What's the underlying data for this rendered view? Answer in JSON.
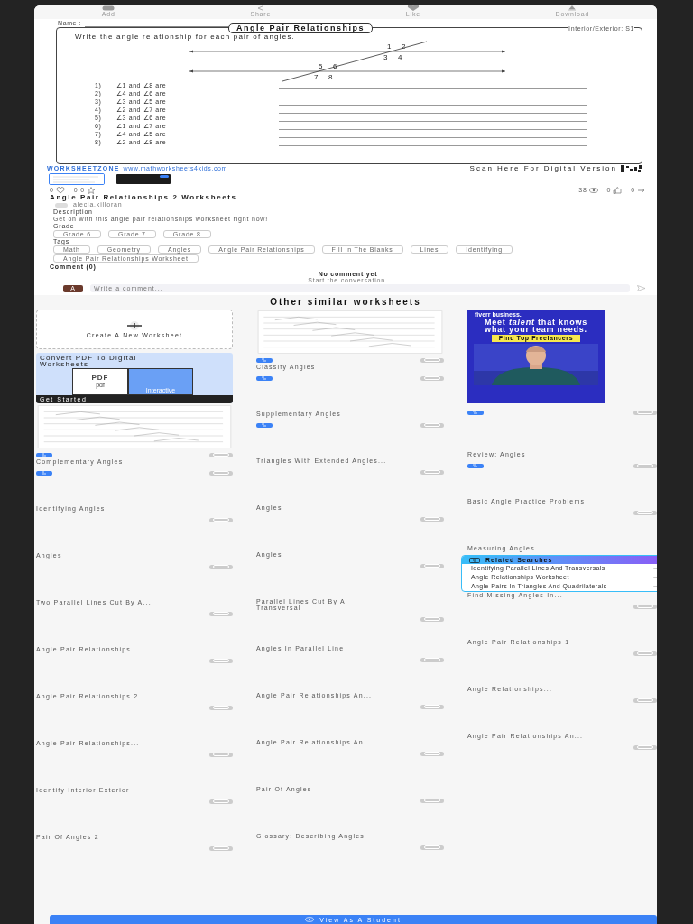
{
  "toolbar": [
    {
      "kind": "add",
      "label": "Add"
    },
    {
      "kind": "share",
      "label": "Share"
    },
    {
      "kind": "like",
      "label": "Like"
    },
    {
      "kind": "download",
      "label": "Download"
    }
  ],
  "worksheet": {
    "name_label": "Name :",
    "title": "Angle Pair Relationships",
    "code": "Interior/Exterior: S1",
    "instruction": "Write the angle relationship for each pair of angles.",
    "diagram_labels": [
      "1",
      "2",
      "3",
      "4",
      "5",
      "6",
      "7",
      "8"
    ],
    "questions": [
      {
        "number": "1)",
        "text": "∠1 and ∠8 are"
      },
      {
        "number": "2)",
        "text": "∠4 and ∠6 are"
      },
      {
        "number": "3)",
        "text": "∠3 and ∠5 are"
      },
      {
        "number": "4)",
        "text": "∠2 and ∠7 are"
      },
      {
        "number": "5)",
        "text": "∠3 and ∠6 are"
      },
      {
        "number": "6)",
        "text": "∠1 and ∠7 are"
      },
      {
        "number": "7)",
        "text": "∠4 and ∠5 are"
      },
      {
        "number": "8)",
        "text": "∠2 and ∠8 are"
      }
    ],
    "brand": "WORKSHEETZONE",
    "website": "www.mathworksheets4kids.com",
    "scan_text": "Scan Here For Digital Version"
  },
  "thumbnails": [
    {
      "kind": "worksheet",
      "selected": true
    },
    {
      "kind": "video",
      "selected": false
    }
  ],
  "stats_left": [
    {
      "kind": "heart",
      "value": "0"
    },
    {
      "kind": "star",
      "value": "0.0"
    }
  ],
  "stats_right": [
    {
      "kind": "eye",
      "value": "38"
    },
    {
      "kind": "thumb",
      "value": "0"
    },
    {
      "kind": "share",
      "value": "0"
    }
  ],
  "title": "Angle Pair Relationships 2 Worksheets",
  "author": "alecia.killoran",
  "description_label": "Description",
  "description": "Get on with this angle pair relationships worksheet right now!",
  "grade_label": "Grade",
  "grades": [
    "Grade 6",
    "Grade 7",
    "Grade 8"
  ],
  "tags_label": "Tags",
  "tags": [
    "Math",
    "Geometry",
    "Angles",
    "Angle Pair Relationships",
    "Fill In The Blanks",
    "Lines",
    "Identifying",
    "Angle Pair Relationships Worksheet"
  ],
  "comments": {
    "heading": "Comment (0)",
    "empty_title": "No comment yet",
    "empty_subtitle": "Start the conversation.",
    "avatar_letter": "A",
    "placeholder": "Write a comment..."
  },
  "similar": {
    "heading": "Other similar worksheets",
    "columns": [
      [
        {
          "kind": "create",
          "label": "Create A New Worksheet"
        },
        {
          "kind": "pdf_ad",
          "title": "Convert PDF To Digital Worksheets",
          "pdf": "PDF",
          "pdf_small": "pdf",
          "interactive_label": "Interactive",
          "cta": "Get Started"
        },
        {
          "kind": "worksheet",
          "interactive": true
        },
        {
          "kind": "item",
          "title": "Complementary Angles",
          "interactive": true
        },
        {
          "kind": "item",
          "title": "Identifying Angles",
          "interactive": false
        },
        {
          "kind": "item",
          "title": "Angles",
          "interactive": false
        },
        {
          "kind": "item",
          "title": "Two Parallel Lines Cut By A...",
          "interactive": false
        },
        {
          "kind": "item",
          "title": "Angle Pair Relationships",
          "interactive": false
        },
        {
          "kind": "item",
          "title": "Angle Pair Relationships 2",
          "interactive": false
        },
        {
          "kind": "item",
          "title": "Angle Pair Relationships...",
          "interactive": false
        },
        {
          "kind": "item",
          "title": "Identify Interior Exterior",
          "interactive": false
        },
        {
          "kind": "item",
          "title": "Pair Of Angles 2",
          "interactive": false
        }
      ],
      [
        {
          "kind": "worksheet",
          "interactive": true
        },
        {
          "kind": "item",
          "title": "Classify Angles",
          "interactive": true
        },
        {
          "kind": "item",
          "title": "Supplementary Angles",
          "interactive": true
        },
        {
          "kind": "item",
          "title": "Triangles With Extended Angles...",
          "interactive": false
        },
        {
          "kind": "item",
          "title": "Angles",
          "interactive": false
        },
        {
          "kind": "item",
          "title": "Angles",
          "interactive": false
        },
        {
          "kind": "item",
          "title": "Parallel Lines Cut By A Transversal",
          "interactive": false
        },
        {
          "kind": "item",
          "title": "Angles In Parallel Line",
          "interactive": false
        },
        {
          "kind": "item",
          "title": "Angle Pair Relationships An...",
          "interactive": false
        },
        {
          "kind": "item",
          "title": "Angle Pair Relationships An...",
          "interactive": false
        },
        {
          "kind": "item",
          "title": "Pair Of Angles",
          "interactive": false
        },
        {
          "kind": "item",
          "title": "Glossary: Describing Angles",
          "interactive": false
        }
      ],
      [
        {
          "kind": "fiverr_ad",
          "brand": "fiverr business.",
          "headline": "Meet *talent* that knows what your team needs.",
          "cta": "Find Top Freelancers"
        },
        {
          "kind": "item",
          "interactive": true
        },
        {
          "kind": "item",
          "title": "Review: Angles",
          "interactive": true
        },
        {
          "kind": "item",
          "title": "Basic Angle Practice Problems",
          "interactive": false
        },
        {
          "kind": "item",
          "title": "Measuring Angles"
        },
        {
          "kind": "item",
          "title": "Find Missing Angles In...",
          "interactive": false
        },
        {
          "kind": "item",
          "title": "Angle Pair Relationships 1",
          "interactive": false
        },
        {
          "kind": "item",
          "title": "Angle Relationships...",
          "interactive": false
        },
        {
          "kind": "item",
          "title": "Angle Pair Relationships An...",
          "interactive": false
        }
      ]
    ]
  },
  "related_searches": {
    "title": "Related Searches",
    "items": [
      "Identifying Parallel Lines And Transversals",
      "Angle Relationships Worksheet",
      "Angle Pairs In Triangles And Quadrilaterals"
    ]
  },
  "student_button": "View As A Student"
}
